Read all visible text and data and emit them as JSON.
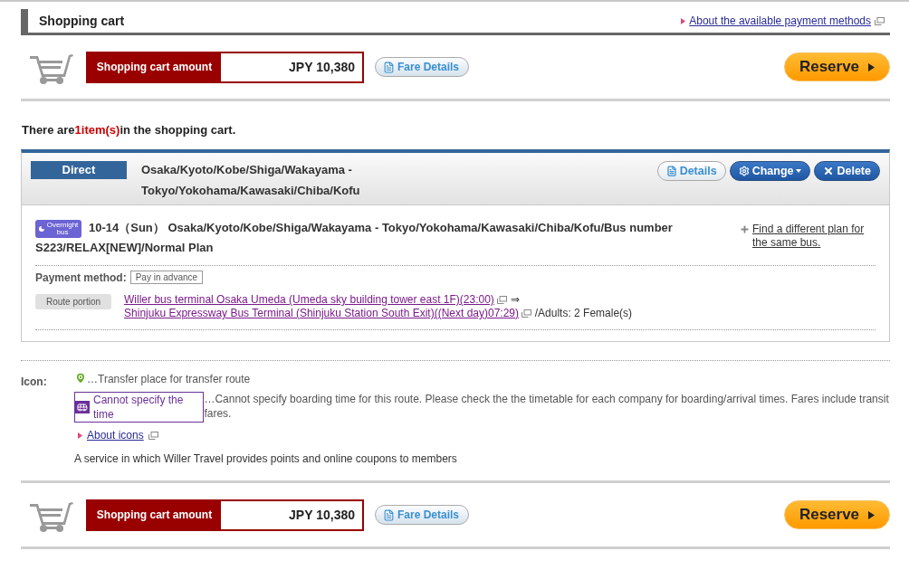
{
  "header": {
    "title": "Shopping cart",
    "payment_link": "About the available payment methods"
  },
  "cart_bars": [
    {
      "label": "Shopping cart amount",
      "amount": "JPY 10,380",
      "fare_button": "Fare Details",
      "reserve_button": "Reserve"
    },
    {
      "label": "Shopping cart amount",
      "amount": "JPY 10,380",
      "fare_button": "Fare Details",
      "reserve_button": "Reserve"
    }
  ],
  "count_sentence": {
    "before": "There are",
    "count": "1item(s)",
    "after": "in the shopping cart."
  },
  "item": {
    "type_label": "Direct",
    "route": "Osaka/Kyoto/Kobe/Shiga/Wakayama - Tokyo/Yokohama/Kawasaki/Chiba/Kofu",
    "buttons": [
      {
        "kind": "details",
        "label": "Details"
      },
      {
        "kind": "change",
        "label": "Change"
      },
      {
        "kind": "delete",
        "label": "Delete"
      }
    ],
    "badge": "Overnight bus",
    "plan": "10-14（Sun） Osaka/Kyoto/Kobe/Shiga/Wakayama - Tokyo/Yokohama/Kawasaki/Chiba/Kofu/Bus number S223/RELAX[NEW]/Normal Plan",
    "other_plan_link": "Find a different plan for the same bus.",
    "payment_label": "Payment method:",
    "payment_value": "Pay in advance",
    "route_label": "Route portion",
    "departure": "Willer bus terminal Osaka Umeda (Umeda sky building tower east 1F)(23:00)",
    "arrow": "⇒",
    "arrival": "Shinjuku Expressway Bus Terminal (Shinjuku Station South Exit)((Next day)07:29)",
    "passengers": "/Adults: 2 Female(s)"
  },
  "legend": {
    "label": "Icon:",
    "entries": [
      {
        "kind": "pin",
        "text": "…Transfer place for transfer route"
      },
      {
        "kind": "tag",
        "tag": "Cannot specify the time",
        "text": "…Cannot specify boarding time for this route. Please check the the timetable for each company for boarding/arrival times. Fares include transit fares."
      }
    ],
    "link": "About icons",
    "note": "A service in which Willer Travel provides points and online coupons to members"
  }
}
